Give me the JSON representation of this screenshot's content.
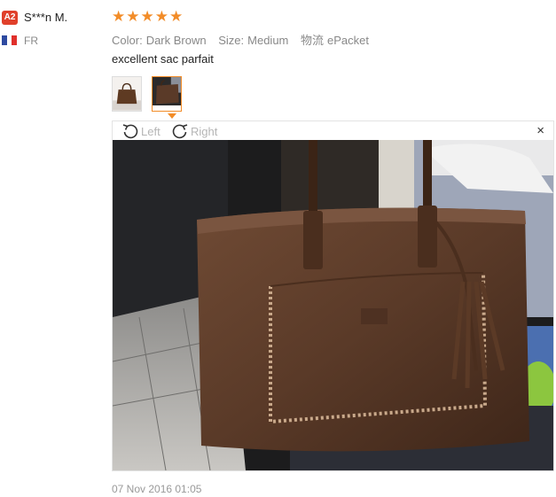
{
  "user": {
    "level": "A2",
    "name": "S***n M.",
    "country": "FR",
    "colors": {
      "level_badge": "#e0402b",
      "flag": [
        "#2e4aa0",
        "#ffffff",
        "#e0302b"
      ]
    }
  },
  "review": {
    "rating": 5,
    "star_glyph": "★",
    "star_color": "#f28c28",
    "attributes": [
      {
        "key": "Color:",
        "value": "Dark Brown"
      },
      {
        "key": "Size:",
        "value": "Medium"
      },
      {
        "key": "物流",
        "value": "ePacket"
      }
    ],
    "text": "excellent sac parfait",
    "date": "07 Nov 2016 01:05"
  },
  "viewer": {
    "rotate_left_label": "Left",
    "rotate_right_label": "Right",
    "close_glyph": "×"
  },
  "thumbnails": [
    {
      "name": "photo-1",
      "active": false
    },
    {
      "name": "photo-2",
      "active": true
    }
  ]
}
